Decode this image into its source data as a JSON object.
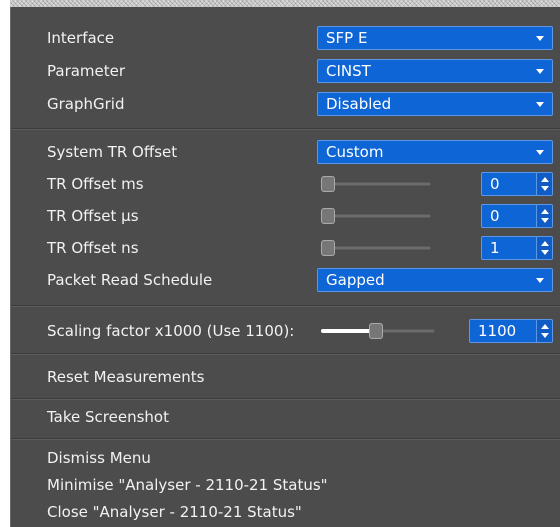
{
  "settings": [
    {
      "label": "Interface",
      "value": "SFP E"
    },
    {
      "label": "Parameter",
      "value": "CINST"
    },
    {
      "label": "GraphGrid",
      "value": "Disabled"
    }
  ],
  "offset": {
    "system_label": "System TR Offset",
    "system_value": "Custom",
    "ms_label": "TR Offset ms",
    "ms_value": "0",
    "us_label": "TR Offset µs",
    "us_value": "0",
    "ns_label": "TR Offset ns",
    "ns_value": "1",
    "schedule_label": "Packet Read Schedule",
    "schedule_value": "Gapped"
  },
  "scaling": {
    "label": "Scaling factor x1000 (Use 1100):",
    "value": "1100",
    "slider_fraction": 0.55
  },
  "actions": {
    "reset": "Reset Measurements",
    "screenshot": "Take Screenshot",
    "dismiss": "Dismiss Menu",
    "minimise": "Minimise \"Analyser - 2110-21 Status\"",
    "close": "Close \"Analyser - 2110-21 Status\""
  },
  "colors": {
    "panel": "#4c4c4c",
    "accent": "#0e66d6",
    "text": "#f2f2f2"
  }
}
